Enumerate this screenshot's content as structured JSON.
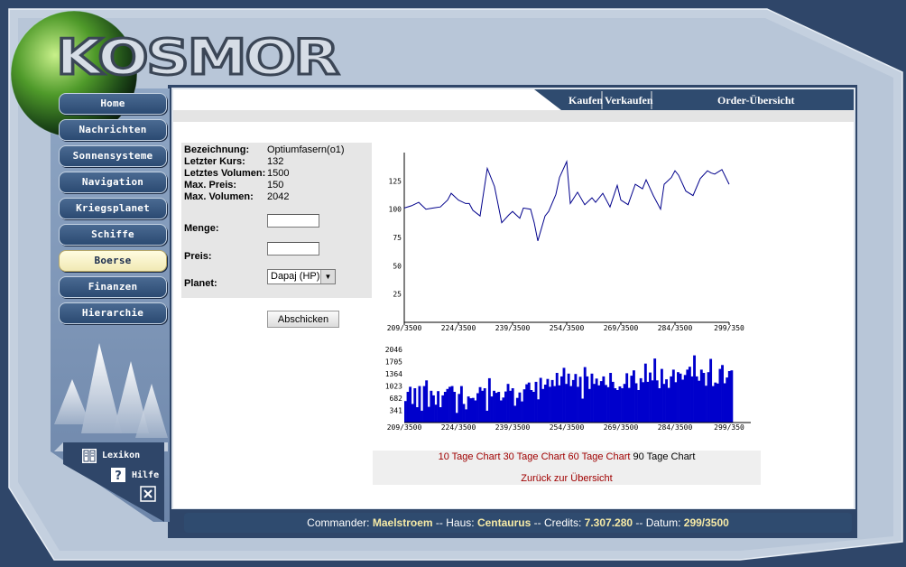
{
  "app": {
    "logo_text": "KOSMOR"
  },
  "nav": {
    "items": [
      {
        "label": "Home"
      },
      {
        "label": "Nachrichten"
      },
      {
        "label": "Sonnensysteme"
      },
      {
        "label": "Navigation"
      },
      {
        "label": "Kriegsplanet"
      },
      {
        "label": "Schiffe"
      },
      {
        "label": "Boerse",
        "active": true
      },
      {
        "label": "Finanzen"
      },
      {
        "label": "Hierarchie"
      }
    ]
  },
  "help": {
    "lexikon_label": "Lexikon",
    "hilfe_label": "Hilfe",
    "book_icon": "book-icon",
    "question_icon": "question-icon",
    "close_icon": "close-icon"
  },
  "tabs": {
    "kaufen": "Kaufen",
    "verkaufen": "Verkaufen",
    "order": "Order-Übersicht"
  },
  "info": {
    "fields": [
      {
        "label": "Bezeichnung:",
        "value": "Optiumfasern(o1)"
      },
      {
        "label": "Letzter Kurs:",
        "value": "132"
      },
      {
        "label": "Letztes Volumen:",
        "value": "1500"
      },
      {
        "label": "Max. Preis:",
        "value": "150"
      },
      {
        "label": "Max. Volumen:",
        "value": "2042"
      }
    ],
    "menge_label": "Menge:",
    "preis_label": "Preis:",
    "planet_label": "Planet:",
    "planet_value": "Dapaj (HP)",
    "menge_value": "",
    "preis_value": "",
    "submit_label": "Abschicken"
  },
  "links": {
    "ten": "10 Tage Chart",
    "thirty": "30 Tage Chart",
    "sixty": "60 Tage Chart",
    "ninety": "90 Tage Chart",
    "back": "Zurück zur Übersicht"
  },
  "status": {
    "commander_label": "Commander:",
    "commander": "Maelstroem",
    "haus_label": "Haus:",
    "haus": "Centaurus",
    "credits_label": "Credits:",
    "credits": "7.307.280",
    "datum_label": "Datum:",
    "datum": "299/3500",
    "sep": "--"
  },
  "colors": {
    "line": "#00008b",
    "bar": "#0000cc",
    "accent": "#2f4b6f",
    "link": "#a00000"
  },
  "chart_data": [
    {
      "type": "line",
      "title": "",
      "xlabel": "",
      "ylabel": "",
      "x_ticks": [
        "209/3500",
        "224/3500",
        "239/3500",
        "254/3500",
        "269/3500",
        "284/3500",
        "299/350"
      ],
      "y_ticks": [
        25,
        50,
        75,
        100,
        125
      ],
      "ylim": [
        0,
        150
      ],
      "xlim": [
        209,
        299
      ],
      "x": [
        209,
        211,
        213,
        215,
        217,
        219,
        221,
        222,
        224,
        226,
        227,
        228,
        230,
        232,
        234,
        236,
        238,
        239,
        241,
        242,
        244,
        245,
        246,
        248,
        249,
        251,
        252,
        254,
        255,
        257,
        259,
        261,
        262,
        264,
        266,
        268,
        269,
        271,
        273,
        275,
        276,
        278,
        280,
        281,
        283,
        284,
        285,
        287,
        289,
        291,
        293,
        294,
        295,
        297,
        299
      ],
      "values": [
        101,
        103,
        106,
        100,
        101,
        102,
        108,
        114,
        108,
        105,
        105,
        99,
        94,
        136,
        120,
        88,
        95,
        98,
        92,
        101,
        100,
        88,
        72,
        94,
        98,
        113,
        128,
        142,
        105,
        115,
        104,
        110,
        106,
        114,
        102,
        121,
        108,
        104,
        122,
        118,
        126,
        112,
        100,
        122,
        128,
        134,
        130,
        116,
        112,
        127,
        134,
        132,
        131,
        135,
        122
      ],
      "grid": false
    },
    {
      "type": "bar",
      "title": "",
      "y_ticks": [
        341,
        682,
        1023,
        1364,
        1705,
        2046
      ],
      "ylim": [
        0,
        2046
      ],
      "x_ticks": [
        "209/3500",
        "224/3500",
        "239/3500",
        "254/3500",
        "269/3500",
        "284/3500",
        "299/350"
      ],
      "values": [
        600,
        860,
        1000,
        520,
        960,
        430,
        1020,
        330,
        1020,
        1180,
        440,
        890,
        760,
        500,
        880,
        430,
        760,
        860,
        940,
        1000,
        1020,
        860,
        270,
        800,
        1020,
        520,
        370,
        730,
        680,
        690,
        620,
        820,
        990,
        890,
        960,
        330,
        1240,
        730,
        890,
        830,
        860,
        620,
        700,
        870,
        1080,
        890,
        960,
        470,
        690,
        840,
        590,
        930,
        1070,
        1120,
        910,
        860,
        1140,
        650,
        1250,
        940,
        1060,
        1220,
        1000,
        1190,
        1020,
        1390,
        1040,
        1290,
        1530,
        1080,
        1370,
        1020,
        1190,
        1360,
        1000,
        1280,
        670,
        1550,
        1290,
        940,
        1370,
        1080,
        1230,
        1040,
        1160,
        1290,
        1050,
        990,
        1390,
        1140,
        960,
        910,
        1010,
        960,
        1080,
        1380,
        970,
        1310,
        1460,
        1100,
        910,
        1240,
        1130,
        1650,
        1140,
        1400,
        1180,
        1790,
        1180,
        960,
        1500,
        1080,
        1210,
        970,
        1290,
        1480,
        1130,
        1410,
        1370,
        1200,
        1330,
        1480,
        1560,
        1290,
        1880,
        1290,
        1170,
        1480,
        1390,
        1030,
        1410,
        1780,
        1020,
        1120,
        1090,
        1500,
        1610,
        1100,
        1260,
        1440,
        1460
      ]
    }
  ]
}
